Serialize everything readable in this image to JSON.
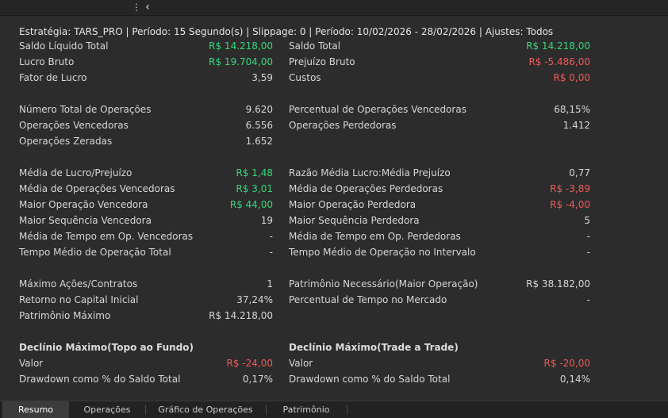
{
  "topbar": {
    "menu_glyph": "⋮",
    "back_glyph": "‹"
  },
  "header": "Estratégia: TARS_PRO | Período: 15 Segundo(s) | Slippage: 0 | Período: 10/02/2026 - 28/02/2026 | Ajustes: Todos",
  "rows": [
    {
      "l_label": "Saldo Líquido Total",
      "l_value": "R$ 14.218,00",
      "r_label": "Saldo Total",
      "r_value": "R$ 14.218,00"
    },
    {
      "l_label": "Lucro Bruto",
      "l_value": "R$ 19.704,00",
      "r_label": "Prejuízo Bruto",
      "r_value": "R$ -5.486,00"
    },
    {
      "l_label": "Fator de Lucro",
      "l_value": "3,59",
      "r_label": "Custos",
      "r_value": "R$ 0,00"
    },
    {
      "l_label": "Número Total de Operações",
      "l_value": "9.620",
      "r_label": "Percentual de Operações Vencedoras",
      "r_value": "68,15%"
    },
    {
      "l_label": "Operações Vencedoras",
      "l_value": "6.556",
      "r_label": "Operações Perdedoras",
      "r_value": "1.412"
    },
    {
      "l_label": "Operações Zeradas",
      "l_value": "1.652",
      "r_label": "",
      "r_value": ""
    },
    {
      "l_label": "Média de Lucro/Prejuízo",
      "l_value": "R$ 1,48",
      "r_label": "Razão Média Lucro:Média Prejuízo",
      "r_value": "0,77"
    },
    {
      "l_label": "Média de Operações Vencedoras",
      "l_value": "R$ 3,01",
      "r_label": "Média de Operações Perdedoras",
      "r_value": "R$ -3,89"
    },
    {
      "l_label": "Maior Operação Vencedora",
      "l_value": "R$ 44,00",
      "r_label": "Maior Operação Perdedora",
      "r_value": "R$ -4,00"
    },
    {
      "l_label": "Maior Sequência Vencedora",
      "l_value": "19",
      "r_label": "Maior Sequência Perdedora",
      "r_value": "5"
    },
    {
      "l_label": "Média de Tempo em Op. Vencedoras",
      "l_value": "-",
      "r_label": "Média de Tempo em Op. Perdedoras",
      "r_value": "-"
    },
    {
      "l_label": "Tempo Médio de Operação Total",
      "l_value": "-",
      "r_label": "Tempo Médio de Operação no Intervalo",
      "r_value": "-"
    },
    {
      "l_label": "Máximo Ações/Contratos",
      "l_value": "1",
      "r_label": "Patrimônio Necessário(Maior Operação)",
      "r_value": "R$ 38.182,00"
    },
    {
      "l_label": "Retorno no Capital Inicial",
      "l_value": "37,24%",
      "r_label": "Percentual de Tempo no Mercado",
      "r_value": "-"
    },
    {
      "l_label": "Patrimônio Máximo",
      "l_value": "R$ 14.218,00",
      "r_label": "",
      "r_value": ""
    }
  ],
  "drawdown": {
    "left_title": "Declínio Máximo(Topo ao Fundo)",
    "right_title": "Declínio Máximo(Trade a Trade)",
    "rows": [
      {
        "l_label": "Valor",
        "l_value": "R$ -24,00",
        "r_label": "Valor",
        "r_value": "R$ -20,00"
      },
      {
        "l_label": "Drawdown como % do Saldo Total",
        "l_value": "0,17%",
        "r_label": "Drawdown como % do Saldo Total",
        "r_value": "0,14%"
      }
    ]
  },
  "tabs": [
    "Resumo",
    "Operações",
    "Gráfico de Operações",
    "Patrimônio"
  ],
  "colors": {
    "positive": "#37d67a",
    "negative": "#ef5a5a"
  }
}
